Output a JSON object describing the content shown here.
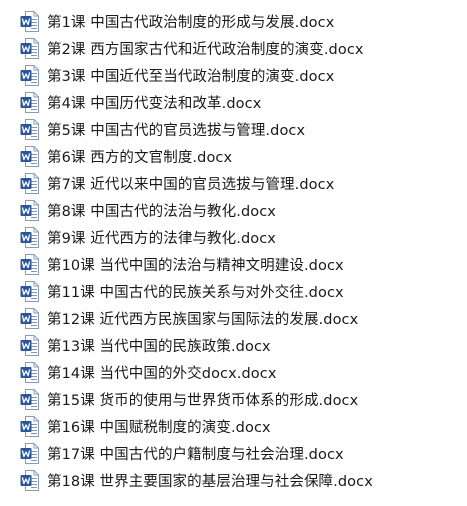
{
  "file_icon": "word-document-icon",
  "icon_color": "#2b579a",
  "files": [
    "第1课 中国古代政治制度的形成与发展.docx",
    "第2课 西方国家古代和近代政治制度的演变.docx",
    "第3课 中国近代至当代政治制度的演变.docx",
    "第4课 中国历代变法和改革.docx",
    "第5课 中国古代的官员选拔与管理.docx",
    "第6课 西方的文官制度.docx",
    "第7课 近代以来中国的官员选拔与管理.docx",
    "第8课 中国古代的法治与教化.docx",
    "第9课 近代西方的法律与教化.docx",
    "第10课 当代中国的法治与精神文明建设.docx",
    "第11课 中国古代的民族关系与对外交往.docx",
    "第12课 近代西方民族国家与国际法的发展.docx",
    "第13课 当代中国的民族政策.docx",
    "第14课 当代中国的外交docx.docx",
    "第15课 货币的使用与世界货币体系的形成.docx",
    "第16课 中国赋税制度的演变.docx",
    "第17课 中国古代的户籍制度与社会治理.docx",
    "第18课 世界主要国家的基层治理与社会保障.docx"
  ]
}
